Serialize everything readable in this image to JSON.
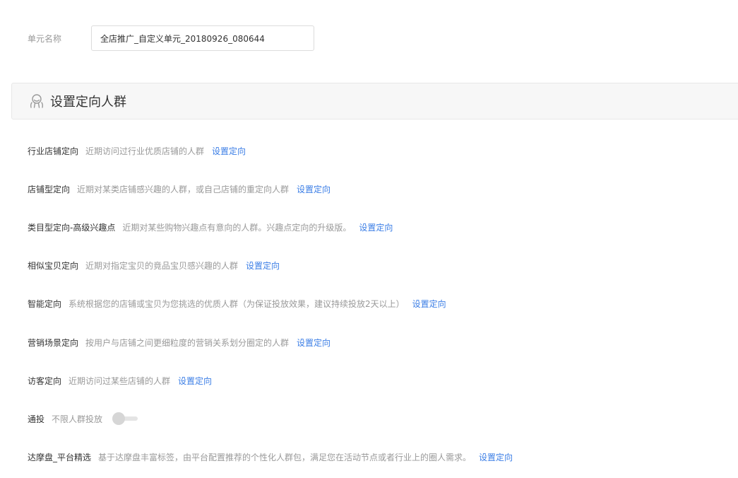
{
  "unit": {
    "label": "单元名称",
    "value": "全店推广_自定义单元_20180926_080644"
  },
  "section": {
    "title": "设置定向人群",
    "icon": "people-group-icon"
  },
  "targets": [
    {
      "name": "行业店铺定向",
      "desc": "近期访问过行业优质店铺的人群",
      "link": "设置定向"
    },
    {
      "name": "店铺型定向",
      "desc": "近期对某类店铺感兴趣的人群，或自己店铺的重定向人群",
      "link": "设置定向"
    },
    {
      "name": "类目型定向-高级兴趣点",
      "desc": "近期对某些购物兴趣点有意向的人群。兴趣点定向的升级版。",
      "link": "设置定向"
    },
    {
      "name": "相似宝贝定向",
      "desc": "近期对指定宝贝的竟品宝贝感兴趣的人群",
      "link": "设置定向"
    },
    {
      "name": "智能定向",
      "desc": "系统根据您的店铺或宝贝为您挑选的优质人群（为保证投放效果，建议持续投放2天以上）",
      "link": "设置定向"
    },
    {
      "name": "营销场景定向",
      "desc": "按用户与店铺之间更细粒度的营销关系划分圈定的人群",
      "link": "设置定向"
    },
    {
      "name": "访客定向",
      "desc": "近期访问过某些店铺的人群",
      "link": "设置定向"
    },
    {
      "name": "通投",
      "desc": "不限人群投放",
      "toggle": false
    },
    {
      "name": "达摩盘_平台精选",
      "desc": "基于达摩盘丰富标签，由平台配置推荐的个性化人群包，满足您在活动节点或者行业上的圈人需求。",
      "link": "设置定向"
    }
  ],
  "colors": {
    "link": "#3b7ee6",
    "muted": "#999999",
    "text": "#333333"
  }
}
